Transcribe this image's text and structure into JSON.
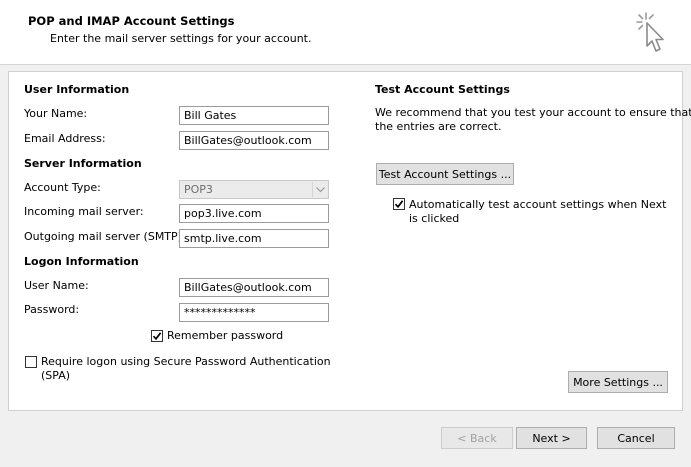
{
  "header": {
    "title": "POP and IMAP Account Settings",
    "subtitle": "Enter the mail server settings for your account."
  },
  "user_info": {
    "heading": "User Information",
    "name_label": "Your Name:",
    "name_value": "Bill Gates",
    "email_label": "Email Address:",
    "email_value": "BillGates@outlook.com"
  },
  "server_info": {
    "heading": "Server Information",
    "account_type_label": "Account Type:",
    "account_type_value": "POP3",
    "incoming_label": "Incoming mail server:",
    "incoming_value": "pop3.live.com",
    "outgoing_label": "Outgoing mail server (SMTP):",
    "outgoing_value": "smtp.live.com"
  },
  "logon_info": {
    "heading": "Logon Information",
    "user_label": "User Name:",
    "user_value": "BillGates@outlook.com",
    "password_label": "Password:",
    "password_value": "*************",
    "remember_label": "Remember password",
    "remember_checked": true,
    "spa_label_line1": "Require logon using Secure Password Authentication",
    "spa_label_line2": "(SPA)",
    "spa_checked": false
  },
  "test_settings": {
    "heading": "Test Account Settings",
    "description_line1": "We recommend that you test your account to ensure that",
    "description_line2": "the entries are correct.",
    "test_button": "Test Account Settings ...",
    "auto_test_line1": "Automatically test account settings when Next",
    "auto_test_line2": "is clicked",
    "auto_test_checked": true
  },
  "more_settings_button": "More Settings ...",
  "footer": {
    "back_button": "< Back",
    "next_button": "Next >",
    "cancel_button": "Cancel"
  },
  "icons": {
    "header_icon": "cursor-click-icon",
    "checkmark": "checkmark-icon",
    "dropdown": "chevron-down-icon"
  }
}
